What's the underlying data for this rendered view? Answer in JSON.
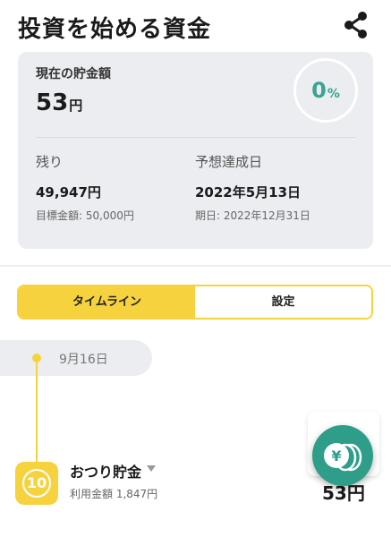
{
  "header": {
    "title": "投資を始める資金",
    "share_icon": "share-icon"
  },
  "summary": {
    "current_label": "現在の貯金額",
    "current_value": "53",
    "current_unit": "円",
    "progress_value": "0",
    "progress_unit": "%",
    "progress_fraction": 0.0,
    "remaining_label": "残り",
    "remaining_amount": "49,947円",
    "goal_amount": "目標金額: 50,000円",
    "forecast_label": "予想達成日",
    "forecast_date": "2022年5月13日",
    "deadline": "期日: 2022年12月31日"
  },
  "tabs": [
    {
      "label": "タイムライン",
      "active": true
    },
    {
      "label": "設定",
      "active": false
    }
  ],
  "timeline": {
    "date": "9月16日",
    "entries": [
      {
        "badge": "10",
        "title": "おつり貯金",
        "subtitle": "利用金額 1,847円",
        "amount": "53円"
      }
    ]
  },
  "fab": {
    "icon": "yen-coins-icon"
  },
  "colors": {
    "accent_yellow": "#f7d23f",
    "accent_teal": "#2e9e8a",
    "progress_teal": "#3aa394",
    "card_bg": "#ecedf1"
  }
}
